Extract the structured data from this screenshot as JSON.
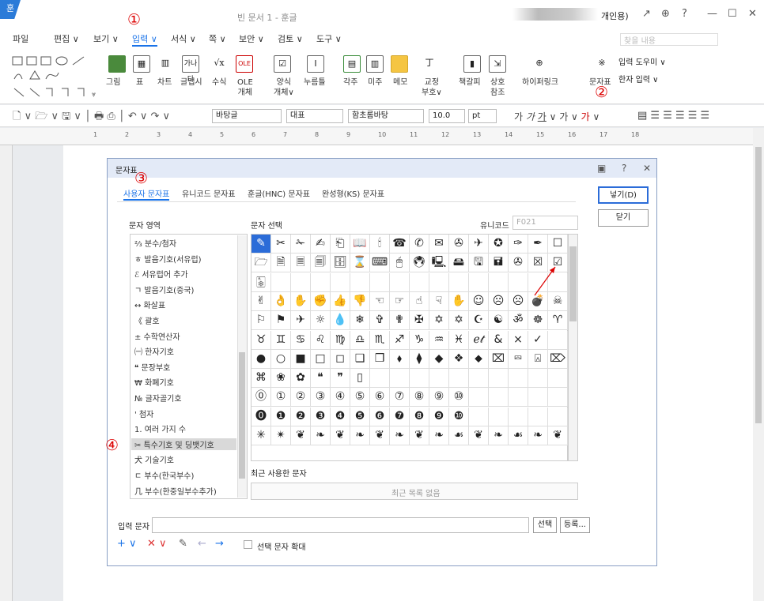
{
  "window": {
    "app_icon": "훈",
    "title": "빈 문서 1 - 훈글",
    "user": "개인용)",
    "controls": [
      "↗",
      "⊕",
      "?",
      "—",
      "☐",
      "✕"
    ]
  },
  "menu": {
    "items": [
      "파일",
      "편집 ∨",
      "보기 ∨",
      "입력 ∨",
      "서식 ∨",
      "쪽 ∨",
      "보안 ∨",
      "검토 ∨",
      "도구 ∨"
    ],
    "active_index": 3,
    "search": "찾을 내용"
  },
  "ribbon": {
    "labels": [
      "그림",
      "표",
      "차트",
      "글맵시",
      "수식",
      "OLE\n개체",
      "양식\n개체∨",
      "누름틀",
      "각주",
      "미주",
      "메모",
      "교정\n부호∨",
      "책갈피",
      "상호\n참조",
      "하이퍼링크",
      "문자표",
      "입력 도우미 ∨",
      "한자 입력 ∨"
    ]
  },
  "format": {
    "style": "바탕글",
    "font_type": "대표",
    "font": "함초롬바탕",
    "size": "10.0",
    "unit": "pt"
  },
  "ruler": {
    "numbers": [
      "1",
      "2",
      "3",
      "4",
      "5",
      "6",
      "7",
      "8",
      "9",
      "10",
      "11",
      "12",
      "13",
      "14",
      "15",
      "16",
      "17",
      "18"
    ]
  },
  "annotations": {
    "n1": "①",
    "n2": "②",
    "n3": "③",
    "n4": "④"
  },
  "dialog": {
    "title": "문자표",
    "controls": [
      "▣",
      "?",
      "✕"
    ],
    "tabs": [
      "사용자 문자표",
      "유니코드 문자표",
      "훈글(HNC) 문자표",
      "완성형(KS) 문자표"
    ],
    "insert_button": "넣기(D)",
    "close_button": "닫기",
    "area_label": "문자 영역",
    "select_label": "문자 선택",
    "unicode_label": "유니코드",
    "unicode_value": "F021",
    "areas": [
      "⅔ 분수/첨자",
      "ㅎ 발음기호(서유럽)",
      "ℰ 서유럽어 추가",
      "ㄱ 발음기호(중국)",
      "↔ 화살표",
      "《 괄호",
      "± 수학연산자",
      "㈠ 한자기호",
      "❝ 문장부호",
      "₩ 화폐기호",
      "№ 글자골기호",
      "' 첨자",
      "1. 여러 가지 수",
      "✂ 특수기호 및 딩뱃기호",
      "⽝ 기술기호",
      "ㄷ 부수(한국부수)",
      "⼏ 부수(한중일부수추가)"
    ],
    "selected_area": 13,
    "rows": [
      [
        "✎",
        "✂",
        "✁",
        "✍",
        "⎗",
        "📖",
        "🕯",
        "☎",
        "✆",
        "✉",
        "✇",
        "✈",
        "✪",
        "✑",
        "✒",
        "☐"
      ],
      [
        "🗁",
        "🗎",
        "🗏",
        "🗐",
        "🗄",
        "⌛",
        "⌨",
        "🖱",
        "🖲",
        "🖳",
        "🖴",
        "🖫",
        "🖬",
        "✇",
        "☒",
        "☑"
      ],
      [
        "🀩",
        "",
        "",
        "",
        "",
        "",
        "",
        "",
        "",
        "",
        "",
        "",
        "",
        "",
        "",
        ""
      ],
      [
        "✌",
        "👌",
        "✋",
        "✊",
        "👍",
        "👎",
        "☜",
        "☞",
        "☝",
        "☟",
        "✋",
        "☺",
        "☹",
        "☹",
        "💣",
        "☠"
      ],
      [
        "⚐",
        "⚑",
        "✈",
        "☼",
        "💧",
        "❄",
        "✞",
        "✟",
        "✠",
        "✡",
        "✡",
        "☪",
        "☯",
        "ॐ",
        "☸",
        "♈"
      ],
      [
        "♉",
        "♊",
        "♋",
        "♌",
        "♍",
        "♎",
        "♏",
        "♐",
        "♑",
        "♒",
        "♓",
        "ℯ𝓉",
        "&",
        "×",
        "✓",
        ""
      ],
      [
        "●",
        "○",
        "■",
        "□",
        "◻",
        "❑",
        "❒",
        "⬧",
        "⧫",
        "◆",
        "❖",
        "⬥",
        "⌧",
        "⮹",
        "⍓",
        "⌦"
      ],
      [
        "⌘",
        "❀",
        "✿",
        "❝",
        "❞",
        "▯",
        "",
        "",
        "",
        "",
        "",
        "",
        "",
        "",
        "",
        ""
      ],
      [
        "⓪",
        "①",
        "②",
        "③",
        "④",
        "⑤",
        "⑥",
        "⑦",
        "⑧",
        "⑨",
        "⑩",
        "",
        "",
        "",
        "",
        ""
      ],
      [
        "⓿",
        "❶",
        "❷",
        "❸",
        "❹",
        "❺",
        "❻",
        "❼",
        "❽",
        "❾",
        "❿",
        "",
        "",
        "",
        "",
        ""
      ],
      [
        "✳",
        "✴",
        "❦",
        "❧",
        "❦",
        "❧",
        "❦",
        "❧",
        "❦",
        "❧",
        "☙",
        "❦",
        "❧",
        "☙",
        "❧",
        "❦"
      ]
    ],
    "recent_label": "최근 사용한 문자",
    "recent_empty": "최근 목록 없음",
    "input_label": "입력 문자",
    "select_button": "선택",
    "register_button": "등록...",
    "enlarge_label": "선택 문자 확대"
  }
}
